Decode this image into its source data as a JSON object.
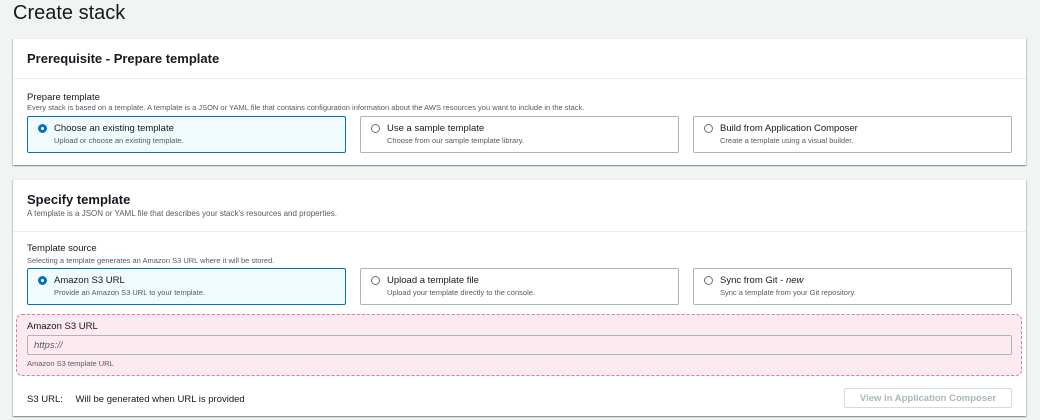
{
  "page": {
    "title": "Create stack"
  },
  "prerequisite": {
    "title": "Prerequisite - Prepare template",
    "field_label": "Prepare template",
    "field_desc": "Every stack is based on a template. A template is a JSON or YAML file that contains configuration information about the AWS resources you want to include in the stack.",
    "options": [
      {
        "label": "Choose an existing template",
        "desc": "Upload or choose an existing template.",
        "selected": true
      },
      {
        "label": "Use a sample template",
        "desc": "Choose from our sample template library.",
        "selected": false
      },
      {
        "label": "Build from Application Composer",
        "desc": "Create a template using a visual builder.",
        "selected": false
      }
    ]
  },
  "specify": {
    "title": "Specify template",
    "desc": "A template is a JSON or YAML file that describes your stack's resources and properties.",
    "source_label": "Template source",
    "source_desc": "Selecting a template generates an Amazon S3 URL where it will be stored.",
    "options": [
      {
        "label": "Amazon S3 URL",
        "label_suffix": "",
        "desc": "Provide an Amazon S3 URL to your template.",
        "selected": true
      },
      {
        "label": "Upload a template file",
        "label_suffix": "",
        "desc": "Upload your template directly to the console.",
        "selected": false
      },
      {
        "label": "Sync from Git - ",
        "label_suffix": "new",
        "desc": "Sync a template from your Git repository.",
        "selected": false
      }
    ],
    "url_field": {
      "label": "Amazon S3 URL",
      "placeholder": "https://",
      "value": "",
      "hint": "Amazon S3 template URL"
    },
    "s3_url": {
      "key": "S3 URL:",
      "value": "Will be generated when URL is provided"
    },
    "view_button": "View in Application Composer"
  },
  "colors": {
    "accent": "#0073bb",
    "selected_bg": "#f1faff",
    "highlight_bg": "#fdeaf1",
    "highlight_border": "#e07aa4"
  }
}
